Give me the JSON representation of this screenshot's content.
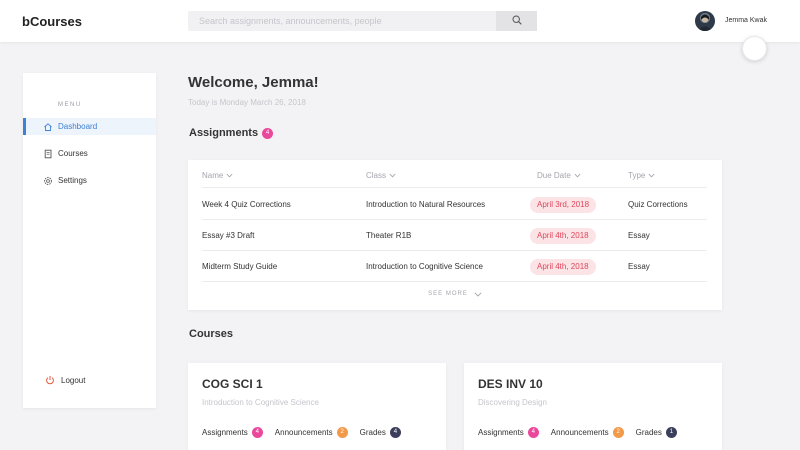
{
  "app": {
    "brand": "bCourses"
  },
  "search": {
    "placeholder": "Search assignments, announcements, people"
  },
  "user": {
    "name": "Jemma Kwak"
  },
  "sidebar": {
    "menu_label": "MENU",
    "items": [
      {
        "label": "Dashboard",
        "icon": "home-icon",
        "active": true
      },
      {
        "label": "Courses",
        "icon": "book-icon",
        "active": false
      },
      {
        "label": "Settings",
        "icon": "gear-icon",
        "active": false
      }
    ],
    "logout_label": "Logout"
  },
  "main": {
    "welcome": "Welcome, Jemma!",
    "today": "Today is Monday March 26, 2018"
  },
  "assignments": {
    "title": "Assignments",
    "count": "4",
    "columns": [
      "Name",
      "Class",
      "Due Date",
      "Type"
    ],
    "rows": [
      {
        "name": "Week 4 Quiz Corrections",
        "class": "Introduction to Natural Resources",
        "due": "April 3rd, 2018",
        "type": "Quiz Corrections"
      },
      {
        "name": "Essay #3 Draft",
        "class": "Theater R1B",
        "due": "April 4th, 2018",
        "type": "Essay"
      },
      {
        "name": "Midterm Study Guide",
        "class": "Introduction to Cognitive Science",
        "due": "April 4th, 2018",
        "type": "Essay"
      }
    ],
    "see_more": "SEE MORE"
  },
  "courses": {
    "title": "Courses",
    "items": [
      {
        "code": "COG SCI 1",
        "name": "Introduction to Cognitive Science",
        "assignments_label": "Assignments",
        "assignments_count": "4",
        "announcements_label": "Announcements",
        "announcements_count": "2",
        "grades_label": "Grades",
        "grades_count": "4"
      },
      {
        "code": "DES INV 10",
        "name": "Discovering Design",
        "assignments_label": "Assignments",
        "assignments_count": "4",
        "announcements_label": "Announcements",
        "announcements_count": "2",
        "grades_label": "Grades",
        "grades_count": "1"
      }
    ]
  },
  "colors": {
    "accent": "#3b83d9",
    "pink_badge": "#e9489b",
    "orange_badge": "#f2994a",
    "navy_badge": "#3b3f5c",
    "due_pill_bg": "#fbe3e6",
    "due_pill_text": "#e0475c"
  }
}
